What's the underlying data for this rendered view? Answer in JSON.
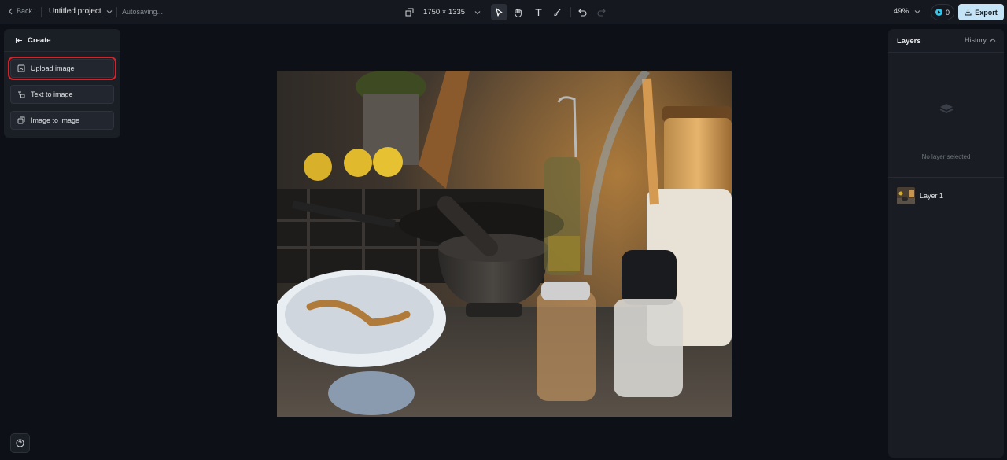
{
  "topbar": {
    "back_label": "Back",
    "project_name": "Untitled project",
    "status": "Autosaving...",
    "canvas_size": "1750 × 1335",
    "zoom": "49%",
    "credits": "0",
    "export_label": "Export"
  },
  "create_panel": {
    "header": "Create",
    "buttons": [
      {
        "label": "Upload image",
        "highlighted": true
      },
      {
        "label": "Text to image"
      },
      {
        "label": "Image to image"
      }
    ]
  },
  "layers_panel": {
    "title": "Layers",
    "history_label": "History",
    "empty_text": "No layer selected",
    "layers": [
      {
        "name": "Layer 1"
      }
    ]
  },
  "colors": {
    "background": "#0d1117",
    "export_button": "#c5e3f6",
    "credit_icon": "#35c5ea",
    "highlight_outline": "#d3242b"
  },
  "icons": [
    "chevron-left-icon",
    "chevron-down-icon",
    "resize-icon",
    "pointer-icon",
    "hand-icon",
    "text-icon",
    "brush-icon",
    "undo-icon",
    "redo-icon",
    "download-icon",
    "arrow-left-icon",
    "upload-image-icon",
    "text-to-image-icon",
    "image-to-image-icon",
    "help-icon",
    "layer-empty-icon",
    "chevron-up-icon"
  ]
}
